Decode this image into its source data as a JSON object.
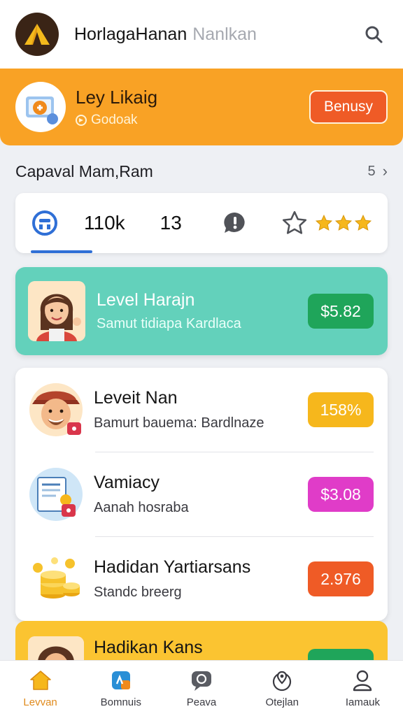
{
  "header": {
    "title": "HorlagaHanan",
    "title_dim": "Nanlkan"
  },
  "promo": {
    "title": "Ley Likaig",
    "subtitle": "Godoak",
    "button_label": "Benusy"
  },
  "section": {
    "title": "Capaval Mam,Ram",
    "count": "5"
  },
  "stats": {
    "value_1": "110k",
    "value_2": "13",
    "rating": 3
  },
  "level_card": {
    "title": "Level Harajn",
    "subtitle": "Samut tidiapa Kardlaca",
    "amount": "$5.82"
  },
  "list": [
    {
      "title": "Leveit Nan",
      "subtitle": "Bamurt bauema: Bardlnaze",
      "badge": "158%",
      "badge_color": "#f6b71c"
    },
    {
      "title": "Vamiacy",
      "subtitle": "Aanah hosraba",
      "badge": "$3.08",
      "badge_color": "#e03cc8"
    },
    {
      "title": "Hadidan Yartiarsans",
      "subtitle": "Standc breerg",
      "badge": "2.976",
      "badge_color": "#ef5b26"
    }
  ],
  "peek": {
    "title": "Hadikan Kans"
  },
  "nav": [
    {
      "label": "Levvan"
    },
    {
      "label": "Bomnuis"
    },
    {
      "label": "Peava"
    },
    {
      "label": "Otejlan"
    },
    {
      "label": "Iamauk"
    }
  ],
  "colors": {
    "accent_orange": "#f9a225",
    "teal": "#63d1bb",
    "green": "#1fa55a",
    "blue": "#2f6fd6"
  }
}
